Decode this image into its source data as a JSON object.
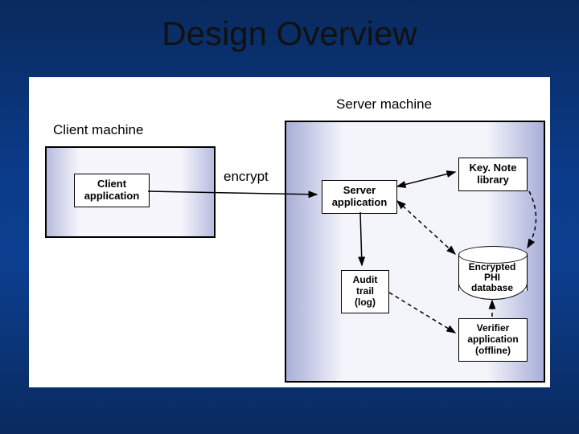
{
  "title": "Design Overview",
  "labels": {
    "client_machine": "Client machine",
    "server_machine": "Server machine",
    "encrypt": "encrypt"
  },
  "boxes": {
    "client_app": "Client\napplication",
    "server_app": "Server\napplication",
    "keynote": "Key. Note\nlibrary",
    "audit": "Audit\ntrail\n(log)",
    "db": "Encrypted\nPHI\ndatabase",
    "verifier": "Verifier\napplication\n(offline)"
  },
  "diagram": {
    "description": "Architecture diagram: client machine sends encrypted data to server machine containing server application, KeyNote library, audit log, encrypted PHI database, and offline verifier",
    "edges": [
      {
        "from": "client_app",
        "to": "server_app",
        "label": "encrypt",
        "style": "solid"
      },
      {
        "from": "server_app",
        "to": "keynote",
        "style": "solid",
        "bidirectional": true
      },
      {
        "from": "server_app",
        "to": "audit",
        "style": "solid"
      },
      {
        "from": "server_app",
        "to": "db",
        "style": "dashed",
        "bidirectional": true
      },
      {
        "from": "audit",
        "to": "verifier",
        "style": "dashed"
      },
      {
        "from": "verifier",
        "to": "db",
        "style": "dashed"
      },
      {
        "from": "keynote",
        "to": "db",
        "style": "dashed",
        "curved": true
      }
    ]
  }
}
